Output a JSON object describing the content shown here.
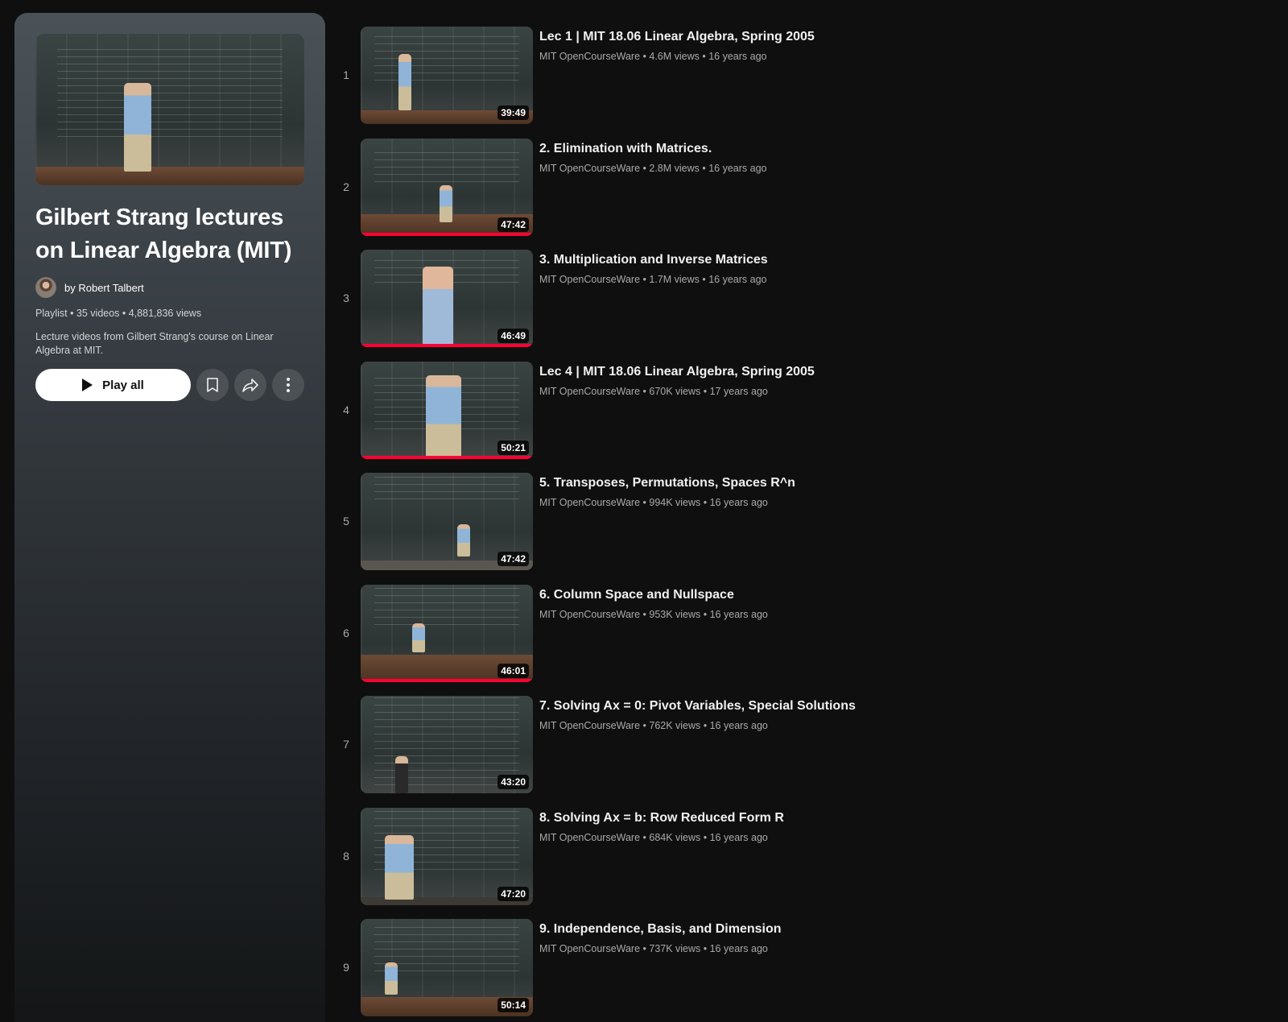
{
  "playlist": {
    "title": "Gilbert Strang lectures on Linear Algebra (MIT)",
    "owner": "by Robert Talbert",
    "meta": "Playlist • 35 videos • 4,881,836 views",
    "description": "Lecture videos from Gilbert Strang's course on Linear Algebra at MIT.",
    "play_all_label": "Play all"
  },
  "colors": {
    "background": "#0f0f0f",
    "progress": "#ff0033",
    "accent": "#ffffff"
  },
  "videos": [
    {
      "index": "1",
      "title": "Lec 1 | MIT 18.06 Linear Algebra, Spring 2005",
      "meta": "MIT OpenCourseWare • 4.6M views • 16 years ago",
      "duration": "39:49",
      "watched": 0
    },
    {
      "index": "2",
      "title": "2. Elimination with Matrices.",
      "meta": "MIT OpenCourseWare • 2.8M views • 16 years ago",
      "duration": "47:42",
      "watched": 1
    },
    {
      "index": "3",
      "title": "3. Multiplication and Inverse Matrices",
      "meta": "MIT OpenCourseWare • 1.7M views • 16 years ago",
      "duration": "46:49",
      "watched": 1
    },
    {
      "index": "4",
      "title": "Lec 4 | MIT 18.06 Linear Algebra, Spring 2005",
      "meta": "MIT OpenCourseWare • 670K views • 17 years ago",
      "duration": "50:21",
      "watched": 1
    },
    {
      "index": "5",
      "title": "5. Transposes, Permutations, Spaces R^n",
      "meta": "MIT OpenCourseWare • 994K views • 16 years ago",
      "duration": "47:42",
      "watched": 0
    },
    {
      "index": "6",
      "title": "6. Column Space and Nullspace",
      "meta": "MIT OpenCourseWare • 953K views • 16 years ago",
      "duration": "46:01",
      "watched": 1
    },
    {
      "index": "7",
      "title": "7. Solving Ax = 0: Pivot Variables, Special Solutions",
      "meta": "MIT OpenCourseWare • 762K views • 16 years ago",
      "duration": "43:20",
      "watched": 0
    },
    {
      "index": "8",
      "title": "8. Solving Ax = b: Row Reduced Form R",
      "meta": "MIT OpenCourseWare • 684K views • 16 years ago",
      "duration": "47:20",
      "watched": 0
    },
    {
      "index": "9",
      "title": "9. Independence, Basis, and Dimension",
      "meta": "MIT OpenCourseWare • 737K views • 16 years ago",
      "duration": "50:14",
      "watched": 0
    }
  ]
}
